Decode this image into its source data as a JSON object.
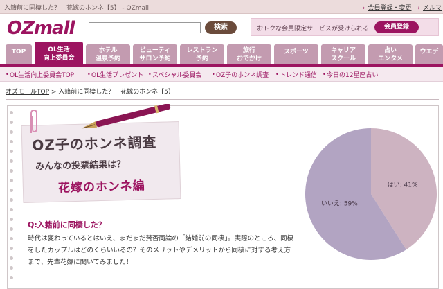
{
  "topbar": {
    "title": "入籍前に同棲した？　花嫁のホンネ【5】 - OZmall",
    "links": [
      "会員登録・変更",
      "メルマ"
    ]
  },
  "header": {
    "logo": "OZmall",
    "search_button": "検索",
    "promo_text": "おトクな会員限定サービスが受けられる",
    "promo_button": "会員登録"
  },
  "nav": {
    "tabs": [
      {
        "l1": "TOP",
        "l2": ""
      },
      {
        "l1": "OL生活",
        "l2": "向上委員会"
      },
      {
        "l1": "ホテル",
        "l2": "温泉予約"
      },
      {
        "l1": "ビューティ",
        "l2": "サロン予約"
      },
      {
        "l1": "レストラン",
        "l2": "予約"
      },
      {
        "l1": "旅行",
        "l2": "おでかけ"
      },
      {
        "l1": "スポーツ",
        "l2": ""
      },
      {
        "l1": "キャリア",
        "l2": "スクール"
      },
      {
        "l1": "占い",
        "l2": "エンタメ"
      },
      {
        "l1": "ウエデ",
        "l2": ""
      }
    ]
  },
  "subnav": [
    "OL生活向上委員会TOP",
    "OL生活プレゼント",
    "スペシャル委員会",
    "OZ子のホンネ調査",
    "トレンド通信",
    "今日の12星座占い"
  ],
  "breadcrumb": {
    "home": "オズモールTOP",
    "sep": " > ",
    "current": "入籍前に同棲した？　花嫁のホンネ【5】"
  },
  "banner": {
    "line1": "OZ子のホンネ調査",
    "line2": "みんなの投票結果は？",
    "line3": "花嫁のホンネ編"
  },
  "question": "Q:入籍前に同棲した？",
  "body": "時代は変わっているとはいえ、まだまだ賛否両論の「結婚前の同棲」。実際のところ、同棲をしたカップルはどのくらいいるの？そのメリットやデメリットから同棲に対する考え方まで、先輩花嫁に聞いてみました！",
  "chart_data": {
    "type": "pie",
    "slices": [
      {
        "label": "はい",
        "value": 41,
        "display": "はい: 41%",
        "color": "#cdb3c1"
      },
      {
        "label": "いいえ",
        "value": 59,
        "display": "いいえ: 59%",
        "color": "#b2a4c2"
      }
    ]
  },
  "colors": {
    "brand": "#9c1460",
    "tab": "#c39bb0"
  }
}
